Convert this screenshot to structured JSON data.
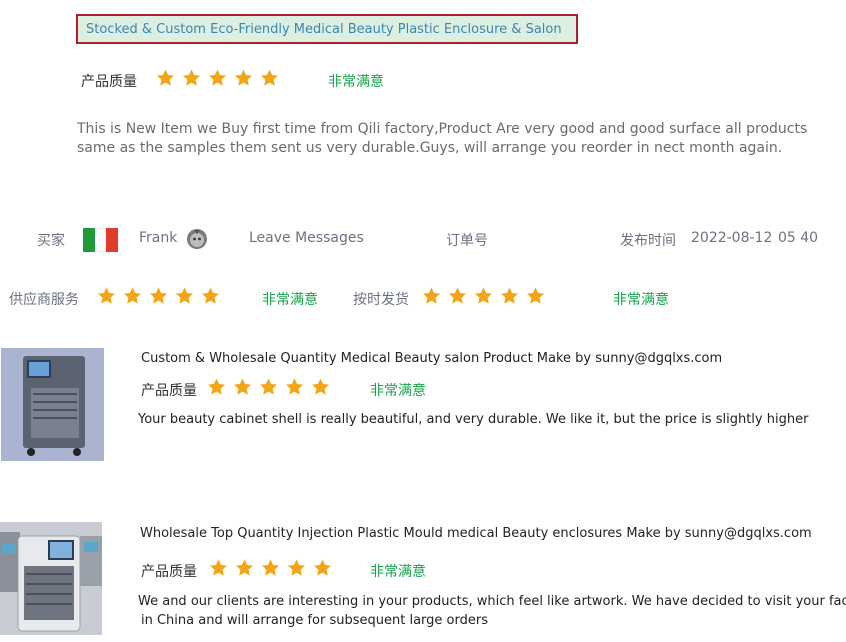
{
  "colors": {
    "star": "#f2a516",
    "satisfied_text": "#16a34a",
    "title_border": "#b0202a",
    "title_bg": "#dcefe0",
    "title_text": "#3a87b5",
    "flag_green": "#1f9a3a",
    "flag_red": "#e23a2e"
  },
  "review": {
    "title": "Stocked & Custom Eco-Friendly Medical Beauty Plastic Enclosure & Salon",
    "quality_label": "产品质量",
    "quality_rating": 5,
    "quality_text": "非常满意",
    "body": "This is New Item we Buy first time from Qili factory,Product Are very good and good surface all products same as the samples them sent us very durable.Guys, will arrange you reorder in nect month again."
  },
  "buyer_row": {
    "buyer_label": "买家",
    "flag_icon": "italy-flag-icon",
    "buyer_name": "Frank",
    "buyer_icon": "user-avatar-icon",
    "leave_messages": "Leave  Messages",
    "order_label": "订单号",
    "publish_label": "发布时间",
    "publish_date": "2022-08-12",
    "publish_time": "05 40"
  },
  "service_row": {
    "supplier_label": "供应商服务",
    "supplier_rating": 5,
    "supplier_text": "非常满意",
    "ontime_label": "按时发货",
    "ontime_rating": 5,
    "ontime_text": "非常满意"
  },
  "products": [
    {
      "image_icon": "beauty-device-cabinet-image",
      "title": "Custom & Wholesale  Quantity Medical Beauty salon Product Make by sunny@dgqlxs.com",
      "quality_label": "产品质量",
      "quality_rating": 5,
      "quality_text": "非常满意",
      "comment": "Your beauty cabinet shell is really beautiful, and very durable. We like it, but the price is slightly higher"
    },
    {
      "image_icon": "beauty-enclosure-factory-image",
      "title": "Wholesale Top Quantity Injection Plastic Mould medical Beauty enclosures Make by sunny@dgqlxs.com",
      "quality_label": "产品质量",
      "quality_rating": 5,
      "quality_text": "非常满意",
      "comment_line1": "We and our clients are interesting in your products, which feel like artwork. We have decided to visit your factory",
      "comment_line2": "in China and will arrange for subsequent large orders"
    }
  ]
}
